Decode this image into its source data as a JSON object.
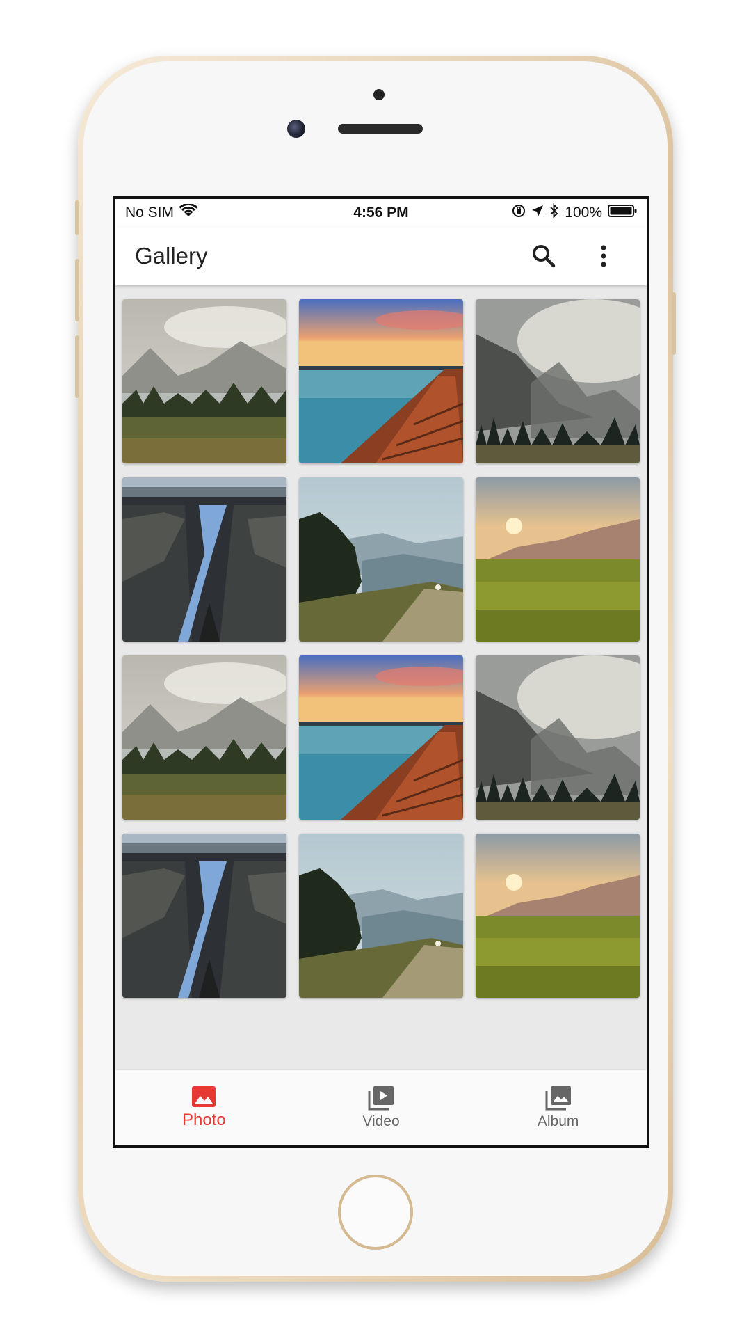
{
  "status_bar": {
    "carrier": "No SIM",
    "time": "4:56 PM",
    "battery": "100%",
    "icons": [
      "wifi-icon",
      "orientation-lock-icon",
      "location-arrow-icon",
      "bluetooth-icon",
      "battery-icon"
    ]
  },
  "app_bar": {
    "title": "Gallery",
    "actions": [
      "search-icon",
      "more-vert-icon"
    ]
  },
  "gallery": {
    "photos": [
      {
        "scene": "misty-lake-mountains"
      },
      {
        "scene": "pier-sunset-lake"
      },
      {
        "scene": "foggy-mountain-forest"
      },
      {
        "scene": "river-canyon"
      },
      {
        "scene": "hillside-trees-valley"
      },
      {
        "scene": "sunset-meadow"
      },
      {
        "scene": "misty-lake-mountains"
      },
      {
        "scene": "pier-sunset-lake"
      },
      {
        "scene": "foggy-mountain-forest"
      },
      {
        "scene": "river-canyon"
      },
      {
        "scene": "hillside-trees-valley"
      },
      {
        "scene": "sunset-meadow"
      }
    ]
  },
  "bottom_nav": {
    "items": [
      {
        "label": "Photo",
        "icon": "photo-icon",
        "active": true
      },
      {
        "label": "Video",
        "icon": "video-library-icon",
        "active": false
      },
      {
        "label": "Album",
        "icon": "photo-library-icon",
        "active": false
      }
    ],
    "active_color": "#e53935",
    "inactive_color": "#666666"
  }
}
